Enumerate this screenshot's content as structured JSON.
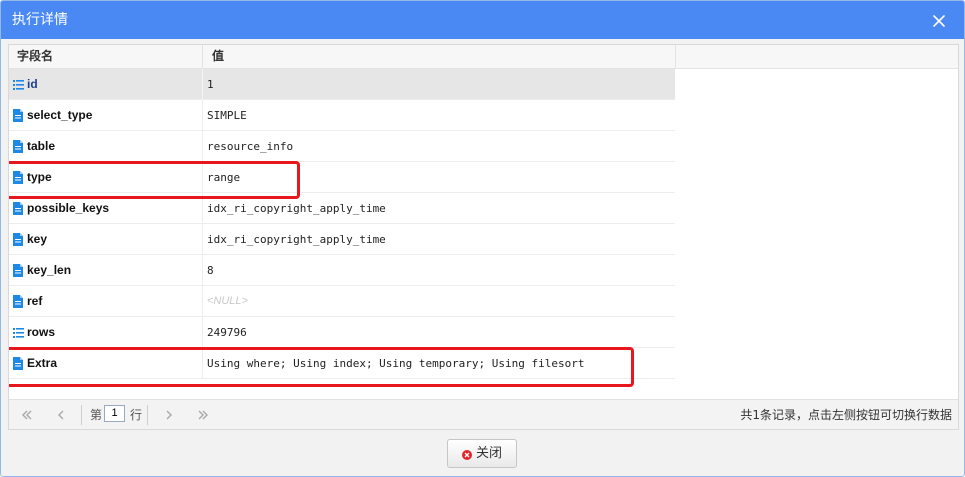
{
  "dialog": {
    "title": "执行详情"
  },
  "table": {
    "headers": [
      "字段名",
      "值"
    ],
    "rows": [
      {
        "icon": "list-number-icon",
        "field": "id",
        "value": "1"
      },
      {
        "icon": "document-icon",
        "field": "select_type",
        "value": "SIMPLE"
      },
      {
        "icon": "document-icon",
        "field": "table",
        "value": "resource_info"
      },
      {
        "icon": "document-icon",
        "field": "type",
        "value": "range"
      },
      {
        "icon": "document-icon",
        "field": "possible_keys",
        "value": "idx_ri_copyright_apply_time"
      },
      {
        "icon": "document-icon",
        "field": "key",
        "value": "idx_ri_copyright_apply_time"
      },
      {
        "icon": "document-icon",
        "field": "key_len",
        "value": "8"
      },
      {
        "icon": "document-icon",
        "field": "ref",
        "value": "<NULL>"
      },
      {
        "icon": "list-number-icon",
        "field": "rows",
        "value": "249796"
      },
      {
        "icon": "document-icon",
        "field": "Extra",
        "value": "Using where; Using index; Using temporary; Using filesort"
      }
    ]
  },
  "pager": {
    "page_prefix": "第",
    "page_value": "1",
    "page_suffix": "行",
    "info": "共1条记录，点击左侧按钮可切换行数据"
  },
  "footer": {
    "close_label": "关闭"
  },
  "colors": {
    "titlebar": "#4a89f3",
    "highlight": "#e8171d",
    "icon_blue": "#1e88e5"
  }
}
